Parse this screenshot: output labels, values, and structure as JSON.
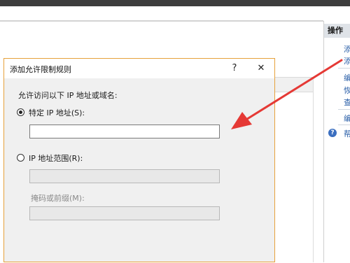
{
  "dialog": {
    "title": "添加允许限制规则",
    "help_glyph": "?",
    "close_glyph": "✕",
    "instruction": "允许访问以下 IP 地址或域名:",
    "specific_ip": {
      "label": "特定 IP 地址(S):",
      "selected": true,
      "value": ""
    },
    "ip_range": {
      "label": "IP 地址范围(R):",
      "selected": false,
      "value": ""
    },
    "mask": {
      "label": "掩码或前缀(M):",
      "value": ""
    }
  },
  "actions_pane": {
    "header": "操作",
    "items": [
      "添",
      "添",
      "编",
      "恢",
      "查",
      "编",
      "帮"
    ]
  },
  "colors": {
    "arrow": "#e53935",
    "dialog_border": "#e6a13b",
    "link": "#2a5fa8"
  },
  "icons": {
    "help": "question-circle-icon",
    "close": "close-icon",
    "arrow": "red-arrow-annotation"
  }
}
